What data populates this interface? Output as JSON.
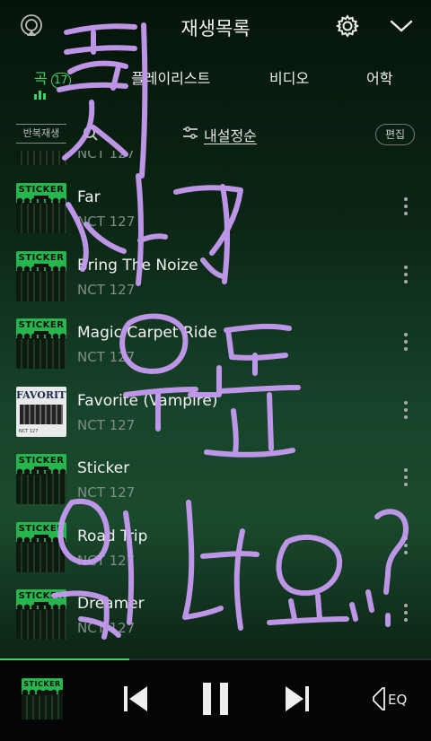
{
  "header": {
    "title": "재생목록",
    "icons": {
      "left": "airplay-icon",
      "settings": "gear-icon",
      "collapse": "chevron-down-icon"
    }
  },
  "tabs": [
    {
      "label": "곡",
      "count": "17",
      "active": true
    },
    {
      "label": "플레이리스트",
      "active": false
    },
    {
      "label": "비디오",
      "active": false
    },
    {
      "label": "어학",
      "active": false
    }
  ],
  "toolbar": {
    "repeat_label": "반복재생",
    "sort_label": "내설정순",
    "edit_label": "편집"
  },
  "songs": [
    {
      "title": "Far",
      "artist": "NCT 127",
      "art": "sticker"
    },
    {
      "title": "Bring The Noize",
      "artist": "NCT 127",
      "art": "sticker"
    },
    {
      "title": "Magic Carpet Ride",
      "artist": "NCT 127",
      "art": "sticker"
    },
    {
      "title": "Favorite (Vampire)",
      "artist": "NCT 127",
      "art": "favorite"
    },
    {
      "title": "Sticker",
      "artist": "NCT 127",
      "art": "sticker"
    },
    {
      "title": "Road Trip",
      "artist": "NCT 127",
      "art": "sticker"
    },
    {
      "title": "Dreamer",
      "artist": "NCT 127",
      "art": "sticker"
    }
  ],
  "partial_row_artist": "NCT 127",
  "album_art_text": {
    "sticker": "STICKER",
    "favorite": "FAVORITE",
    "favorite_foot": "NCT 127"
  },
  "player": {
    "progress": 0.3,
    "eq_label": "EQ",
    "icons": [
      "previous-icon",
      "pause-icon",
      "next-icon",
      "eq-icon"
    ]
  },
  "handwriting": [
    "혹시",
    "사건",
    "원본",
    "있나요...?"
  ],
  "colors": {
    "accent": "#3ad36a",
    "handwriting": "#c79bf2"
  }
}
